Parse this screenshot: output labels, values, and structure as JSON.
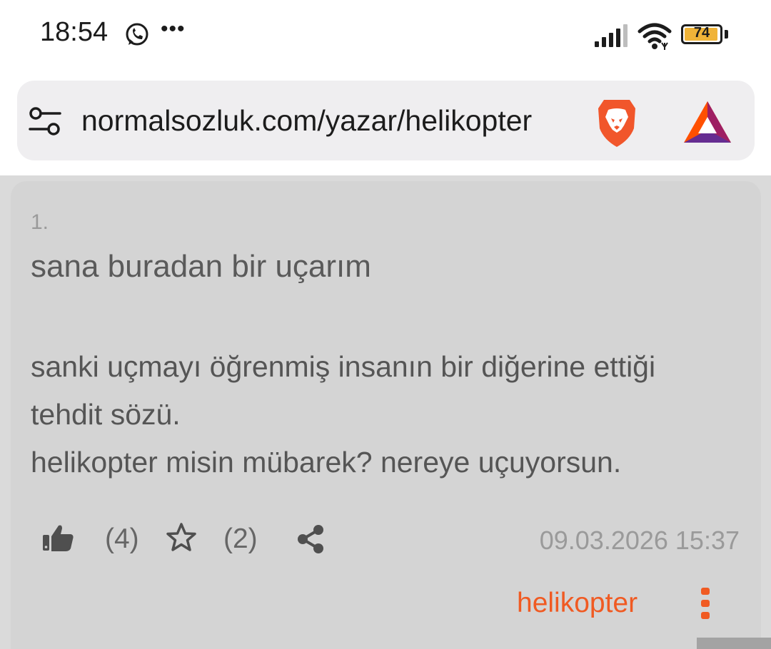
{
  "status_bar": {
    "time": "18:54",
    "notification_icons": [
      "whatsapp-icon",
      "more-dots-icon"
    ],
    "more_dots": "•••",
    "battery_level": "74",
    "battery_color": "#f0b338"
  },
  "browser": {
    "url": "normalsozluk.com/yazar/helikopter",
    "icons": [
      "site-settings-icon",
      "brave-shields-icon",
      "brave-rewards-icon"
    ]
  },
  "entry": {
    "number": "1.",
    "title": "sana buradan bir uçarım",
    "body_lines": [
      "sanki uçmayı öğrenmiş insanın bir diğerine ettiği",
      "tehdit sözü.",
      "helikopter misin mübarek? nereye uçuyorsun."
    ],
    "like_count": "(4)",
    "favorite_count": "(2)",
    "date": "09.03.2026 15:37",
    "author": "helikopter",
    "accent_color": "#f05a22"
  }
}
